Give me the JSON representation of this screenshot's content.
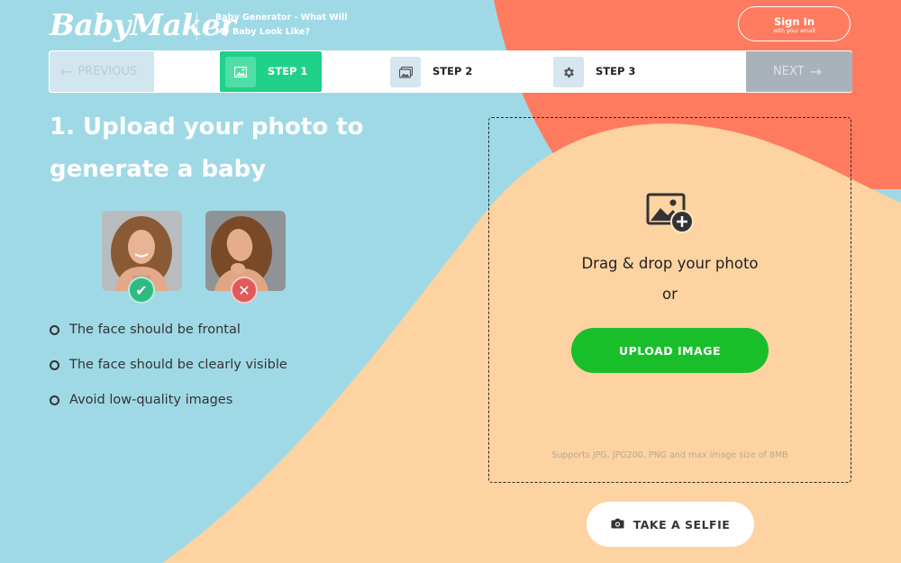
{
  "header": {
    "logo_text": "BabyMaker",
    "tagline": "Baby Generator - What Will My Baby Look Like?",
    "signin": {
      "label": "Sign In",
      "sublabel": "with your email"
    }
  },
  "steps": {
    "previous": "PREVIOUS",
    "next": "NEXT",
    "items": [
      {
        "label": "STEP 1",
        "icon": "image-icon",
        "active": true
      },
      {
        "label": "STEP 2",
        "icon": "images-icon",
        "active": false
      },
      {
        "label": "STEP 3",
        "icon": "gear-icon",
        "active": false
      }
    ]
  },
  "main": {
    "heading": "1. Upload your photo to generate a baby",
    "examples": [
      {
        "status": "good",
        "icon": "check-icon"
      },
      {
        "status": "bad",
        "icon": "close-icon"
      }
    ],
    "rules": [
      "The face should be frontal",
      "The face should be clearly visible",
      "Avoid low-quality images"
    ]
  },
  "dropzone": {
    "icon": "add-image-icon",
    "text": "Drag & drop your photo",
    "or": "or",
    "upload_button": "UPLOAD IMAGE",
    "note": "Supports JPG, JPG200, PNG and max image size of 8MB"
  },
  "selfie": {
    "label": "TAKE A SELFIE",
    "icon": "camera-icon"
  },
  "colors": {
    "blue_bg": "#9fd9e6",
    "coral": "#ff7b5f",
    "peach": "#fdd3a1",
    "step_active": "#1fd18a",
    "upload_green": "#19bf2a"
  }
}
